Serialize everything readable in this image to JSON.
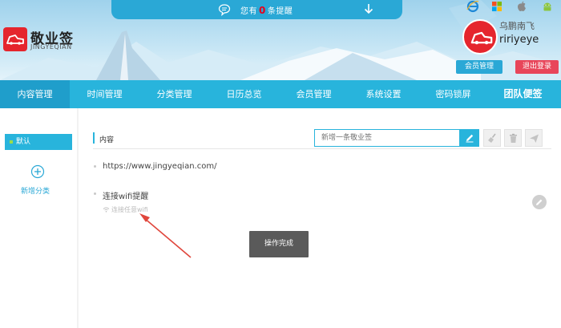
{
  "header": {
    "notice": {
      "prefix": "您有",
      "count": "0",
      "suffix": "条提醒"
    },
    "brand": {
      "title": "敬业签",
      "subtitle": "JINGYEQIAN"
    },
    "platform_icons": [
      "ie-icon",
      "windows-icon",
      "apple-icon",
      "android-icon"
    ],
    "user": {
      "nickname": "乌鹏南飞",
      "id": "ririyeye"
    },
    "member_button": "会员管理",
    "logout_button": "退出登录"
  },
  "nav": {
    "items": [
      "内容管理",
      "时间管理",
      "分类管理",
      "日历总览",
      "会员管理",
      "系统设置",
      "密码锁屏",
      "团队便签"
    ],
    "active_index": 0
  },
  "sidebar": {
    "default_label": "默认",
    "add_category_label": "新增分类"
  },
  "content": {
    "title": "内容",
    "new_note_placeholder": "新增一条敬业签",
    "notes": [
      {
        "text": "https://www.jingyeqian.com/",
        "sub": ""
      },
      {
        "text": "连接wifi提醒",
        "sub": "连接任意wifi"
      }
    ]
  },
  "toast": "操作完成",
  "colors": {
    "primary": "#28b4dc",
    "brand_red": "#e5252d",
    "logout": "#e8465a",
    "annotation_arrow": "#e0463c"
  }
}
